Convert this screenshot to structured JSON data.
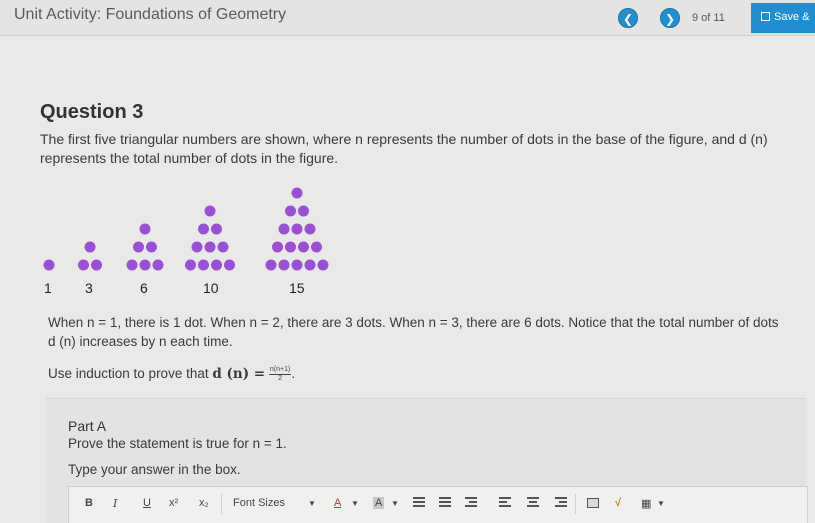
{
  "header": {
    "unit_title": "Unit Activity: Foundations of Geometry",
    "prev_icon": "chevron-left-icon",
    "next_icon": "chevron-right-icon",
    "page_count": "9  of  11",
    "save_label": "Save &",
    "accent": "#1f8fd1"
  },
  "question": {
    "title": "Question 3",
    "prompt": "The first five triangular numbers are shown, where n represents the number of dots in the base of the figure, and d (n) represents the total number of dots in the figure.",
    "dot_color": "#9b4fd8",
    "figures": [
      {
        "rows": 1,
        "label": "1"
      },
      {
        "rows": 2,
        "label": "3"
      },
      {
        "rows": 3,
        "label": "6"
      },
      {
        "rows": 4,
        "label": "10"
      },
      {
        "rows": 5,
        "label": "15"
      }
    ],
    "info": "When n = 1, there is 1 dot. When n = 2, there are 3 dots. When n = 3, there are 6 dots. Notice that the total number of dots d (n) increases by n each time.",
    "induction_prefix": "Use induction to prove that",
    "induction_lhs": "d (n) =",
    "frac_num": "n(n+1)",
    "frac_den": "2",
    "induction_suffix": "."
  },
  "part_a": {
    "title": "Part A",
    "text": "Prove the statement is true for n = 1.",
    "type_label": "Type your answer in the box."
  },
  "toolbar": {
    "bold": "B",
    "italic": "I",
    "underline": "U",
    "superscript": "x²",
    "subscript": "x₂",
    "font_sizes": "Font Sizes",
    "font_color": "A",
    "highlight": "A",
    "icons": [
      "unordered-list-icon",
      "ordered-list-icon",
      "indent-icon",
      "align-left-icon",
      "align-center-icon",
      "align-right-icon",
      "image-icon",
      "sqrt-icon",
      "table-icon"
    ]
  }
}
